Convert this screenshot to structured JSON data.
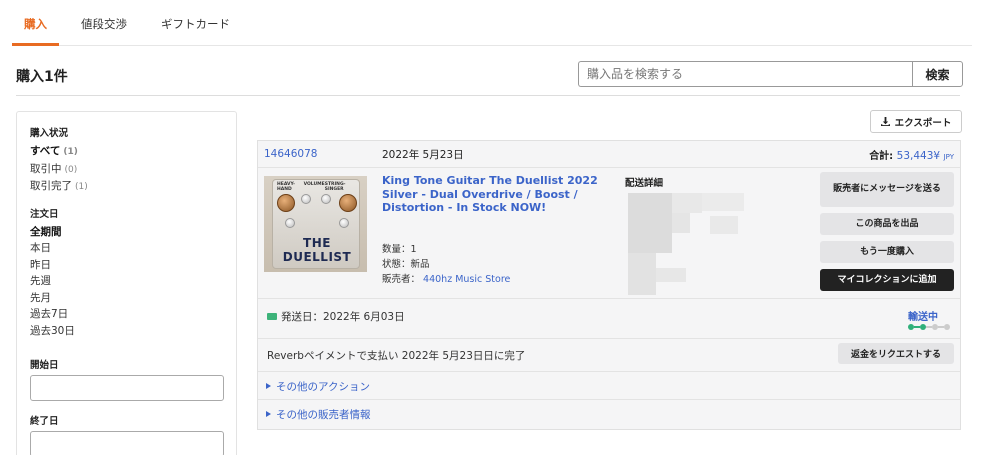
{
  "tabs": [
    {
      "label": "購入",
      "active": true
    },
    {
      "label": "値段交渉",
      "active": false
    },
    {
      "label": "ギフトカード",
      "active": false
    }
  ],
  "page_title": "購入1件",
  "search": {
    "placeholder": "購入品を検索する",
    "button": "検索"
  },
  "sidebar": {
    "status_heading": "購入状況",
    "status_items": [
      {
        "label": "すべて",
        "count": "(1)",
        "active": true
      },
      {
        "label": "取引中",
        "count": "(0)",
        "active": false
      },
      {
        "label": "取引完了",
        "count": "(1)",
        "active": false
      }
    ],
    "date_heading": "注文日",
    "date_items": [
      "全期間",
      "本日",
      "昨日",
      "先週",
      "先月",
      "過去7日",
      "過去30日"
    ],
    "start_label": "開始日",
    "end_label": "終了日"
  },
  "export_label": "エクスポート",
  "order": {
    "id": "14646078",
    "date": "2022年 5月23日",
    "total_label": "合計:",
    "total_amount": "53,443¥",
    "total_currency": "JPY",
    "title": "King Tone Guitar The Duellist 2022 Silver - Dual Overdrive / Boost / Distortion - In Stock NOW!",
    "qty_label": "数量：",
    "qty": "1",
    "condition_label": "状態：",
    "condition": "新品",
    "seller_label": "販売者：",
    "seller": "440hz Music Store",
    "shipping_label": "配送詳細",
    "actions": [
      "販売者にメッセージを送る",
      "この商品を出品",
      "もう一度購入",
      "マイコレクションに追加"
    ],
    "ship_date": "発送日：2022年 6月03日",
    "ship_status": "輸送中",
    "progress_step": 2,
    "progress_total": 4,
    "payment_text": "Reverbペイメントで支払い 2022年 5月23日日に完了",
    "refund_label": "返金をリクエストする",
    "more_actions": "その他のアクション",
    "more_seller": "その他の販売者情報",
    "pedal_text": "THE DUELLIST",
    "pedal_labels": [
      "HEAVY-HAND",
      "VOLUME",
      "STRING-SINGER"
    ]
  }
}
